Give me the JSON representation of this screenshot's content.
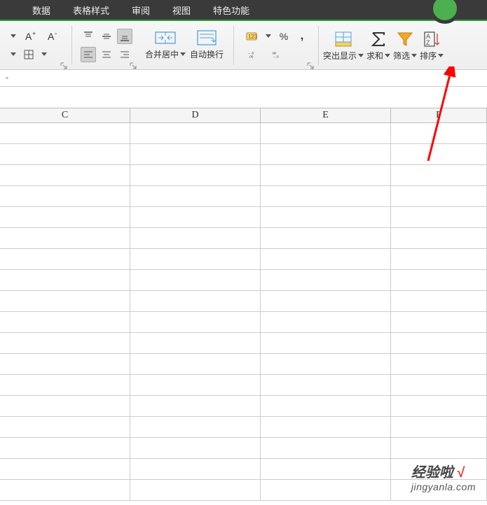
{
  "menu": {
    "items": [
      "数据",
      "表格样式",
      "审阅",
      "视图",
      "特色功能"
    ]
  },
  "ribbon": {
    "merge_center": "合并居中",
    "auto_wrap": "自动换行",
    "percent_symbol": "%",
    "comma_symbol": ",",
    "increase_decimal": ".0",
    "increase_decimal_sub": ".00",
    "decrease_decimal": ".00",
    "decrease_decimal_sub": ".0",
    "highlight": "突出显示",
    "sum": "求和",
    "filter": "筛选",
    "sort": "排序"
  },
  "formula_bar": {
    "content": "-"
  },
  "columns": [
    "C",
    "D",
    "E",
    "F"
  ],
  "watermark": {
    "brand": "经验啦",
    "url": "jingyanla.com"
  }
}
